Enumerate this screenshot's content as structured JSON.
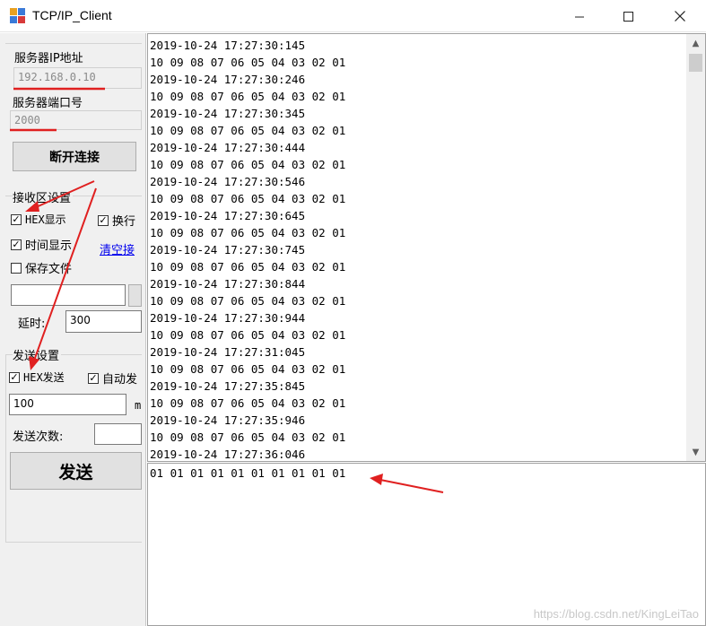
{
  "window": {
    "title": "TCP/IP_Client",
    "minimize_icon": "minimize-icon",
    "maximize_icon": "maximize-icon",
    "close_icon": "close-icon"
  },
  "connection": {
    "ip_label": "服务器IP地址",
    "ip_value": "192.168.0.10",
    "port_label": "服务器端口号",
    "port_value": "2000",
    "disconnect_label": "断开连接"
  },
  "receive_settings": {
    "title": "接收区设置",
    "hex_display_label": "HEX显示",
    "hex_display_checked": true,
    "newline_label": "换行",
    "newline_checked": true,
    "time_display_label": "时间显示",
    "time_display_checked": true,
    "clear_link": "清空接",
    "save_file_label": "保存文件",
    "save_file_checked": false,
    "file_path_value": "",
    "delay_label": "延时:",
    "delay_value": "300"
  },
  "send_settings": {
    "title": "发送设置",
    "hex_send_label": "HEX发送",
    "hex_send_checked": true,
    "auto_send_label": "自动发",
    "auto_send_checked": true,
    "interval_value": "100",
    "interval_unit_partial": "m",
    "send_count_label": "发送次数:",
    "send_count_value": "",
    "send_button_label": "发送"
  },
  "receive_area": {
    "lines": [
      "2019-10-24 17:27:30:145",
      "10 09 08 07 06 05 04 03 02 01",
      "2019-10-24 17:27:30:246",
      "10 09 08 07 06 05 04 03 02 01",
      "2019-10-24 17:27:30:345",
      "10 09 08 07 06 05 04 03 02 01",
      "2019-10-24 17:27:30:444",
      "10 09 08 07 06 05 04 03 02 01",
      "2019-10-24 17:27:30:546",
      "10 09 08 07 06 05 04 03 02 01",
      "2019-10-24 17:27:30:645",
      "10 09 08 07 06 05 04 03 02 01",
      "2019-10-24 17:27:30:745",
      "10 09 08 07 06 05 04 03 02 01",
      "2019-10-24 17:27:30:844",
      "10 09 08 07 06 05 04 03 02 01",
      "2019-10-24 17:27:30:944",
      "10 09 08 07 06 05 04 03 02 01",
      "2019-10-24 17:27:31:045",
      "10 09 08 07 06 05 04 03 02 01",
      "2019-10-24 17:27:35:845",
      "10 09 08 07 06 05 04 03 02 01",
      "2019-10-24 17:27:35:946",
      "10 09 08 07 06 05 04 03 02 01",
      "2019-10-24 17:27:36:046"
    ]
  },
  "send_area": {
    "text": "01 01 01 01 01 01 01 01 01 01"
  },
  "watermark": "https://blog.csdn.net/KingLeiTao",
  "colors": {
    "annotation_red": "#e02020",
    "link_blue": "#0000ee",
    "panel_bg": "#f0f0f0"
  }
}
